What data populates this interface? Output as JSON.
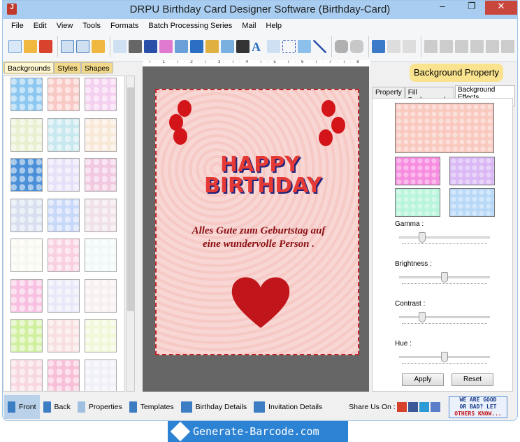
{
  "window": {
    "title": "DRPU Birthday Card Designer Software (Birthday-Card)",
    "minimize": "‒",
    "maximize": "❐",
    "close": "✕"
  },
  "menu": [
    "File",
    "Edit",
    "View",
    "Tools",
    "Formats",
    "Batch Processing Series",
    "Mail",
    "Help"
  ],
  "left_tabs": [
    {
      "label": "Backgrounds",
      "active": true
    },
    {
      "label": "Styles"
    },
    {
      "label": "Shapes"
    }
  ],
  "ruler": "· ı · 1 · ı · 2 · ı · 3 · ı · 4 · ı · 5 · ı · 6 · ı · 7 · ı · 8 · ı · 9 · ı ·",
  "card": {
    "headline": "HAPPY BIRTHDAY",
    "message_line1": "Alles Gute zum Geburtstag auf",
    "message_line2": "eine wundervolle Person ."
  },
  "right": {
    "header": "Background Property",
    "tabs": [
      {
        "label": "Property"
      },
      {
        "label": "Fill Background"
      },
      {
        "label": "Background Effects",
        "active": true
      }
    ],
    "sliders": [
      {
        "label": "Gamma :",
        "value": 0.23
      },
      {
        "label": "Brightness :",
        "value": 0.5
      },
      {
        "label": "Contrast :",
        "value": 0.23
      },
      {
        "label": "Hue :",
        "value": 0.5
      }
    ],
    "apply": "Apply",
    "reset": "Reset",
    "swatches": [
      "#f9c9c0",
      "#f78de0",
      "#d9b8f5",
      "#b8f5dc",
      "#b8d8f8"
    ]
  },
  "bottom": {
    "buttons": [
      "Front",
      "Back",
      "Properties",
      "Templates",
      "Birthday Details",
      "Invitation Details"
    ],
    "active": "Front",
    "share": "Share Us On :",
    "feedback": [
      "WE ARE GOOD",
      "OR BAD? LET",
      "OTHERS KNOW..."
    ]
  },
  "banner": "Generate-Barcode.com"
}
